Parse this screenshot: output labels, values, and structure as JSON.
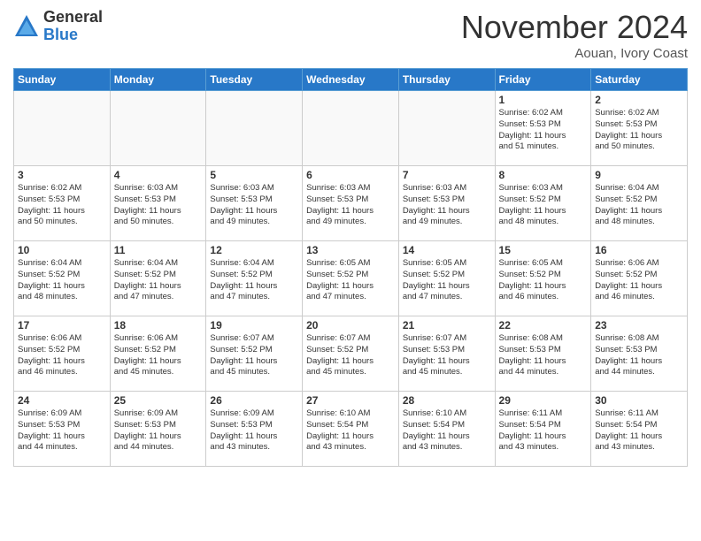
{
  "header": {
    "logo_general": "General",
    "logo_blue": "Blue",
    "month_title": "November 2024",
    "location": "Aouan, Ivory Coast"
  },
  "weekdays": [
    "Sunday",
    "Monday",
    "Tuesday",
    "Wednesday",
    "Thursday",
    "Friday",
    "Saturday"
  ],
  "weeks": [
    [
      {
        "day": "",
        "info": ""
      },
      {
        "day": "",
        "info": ""
      },
      {
        "day": "",
        "info": ""
      },
      {
        "day": "",
        "info": ""
      },
      {
        "day": "",
        "info": ""
      },
      {
        "day": "1",
        "info": "Sunrise: 6:02 AM\nSunset: 5:53 PM\nDaylight: 11 hours\nand 51 minutes."
      },
      {
        "day": "2",
        "info": "Sunrise: 6:02 AM\nSunset: 5:53 PM\nDaylight: 11 hours\nand 50 minutes."
      }
    ],
    [
      {
        "day": "3",
        "info": "Sunrise: 6:02 AM\nSunset: 5:53 PM\nDaylight: 11 hours\nand 50 minutes."
      },
      {
        "day": "4",
        "info": "Sunrise: 6:03 AM\nSunset: 5:53 PM\nDaylight: 11 hours\nand 50 minutes."
      },
      {
        "day": "5",
        "info": "Sunrise: 6:03 AM\nSunset: 5:53 PM\nDaylight: 11 hours\nand 49 minutes."
      },
      {
        "day": "6",
        "info": "Sunrise: 6:03 AM\nSunset: 5:53 PM\nDaylight: 11 hours\nand 49 minutes."
      },
      {
        "day": "7",
        "info": "Sunrise: 6:03 AM\nSunset: 5:53 PM\nDaylight: 11 hours\nand 49 minutes."
      },
      {
        "day": "8",
        "info": "Sunrise: 6:03 AM\nSunset: 5:52 PM\nDaylight: 11 hours\nand 48 minutes."
      },
      {
        "day": "9",
        "info": "Sunrise: 6:04 AM\nSunset: 5:52 PM\nDaylight: 11 hours\nand 48 minutes."
      }
    ],
    [
      {
        "day": "10",
        "info": "Sunrise: 6:04 AM\nSunset: 5:52 PM\nDaylight: 11 hours\nand 48 minutes."
      },
      {
        "day": "11",
        "info": "Sunrise: 6:04 AM\nSunset: 5:52 PM\nDaylight: 11 hours\nand 47 minutes."
      },
      {
        "day": "12",
        "info": "Sunrise: 6:04 AM\nSunset: 5:52 PM\nDaylight: 11 hours\nand 47 minutes."
      },
      {
        "day": "13",
        "info": "Sunrise: 6:05 AM\nSunset: 5:52 PM\nDaylight: 11 hours\nand 47 minutes."
      },
      {
        "day": "14",
        "info": "Sunrise: 6:05 AM\nSunset: 5:52 PM\nDaylight: 11 hours\nand 47 minutes."
      },
      {
        "day": "15",
        "info": "Sunrise: 6:05 AM\nSunset: 5:52 PM\nDaylight: 11 hours\nand 46 minutes."
      },
      {
        "day": "16",
        "info": "Sunrise: 6:06 AM\nSunset: 5:52 PM\nDaylight: 11 hours\nand 46 minutes."
      }
    ],
    [
      {
        "day": "17",
        "info": "Sunrise: 6:06 AM\nSunset: 5:52 PM\nDaylight: 11 hours\nand 46 minutes."
      },
      {
        "day": "18",
        "info": "Sunrise: 6:06 AM\nSunset: 5:52 PM\nDaylight: 11 hours\nand 45 minutes."
      },
      {
        "day": "19",
        "info": "Sunrise: 6:07 AM\nSunset: 5:52 PM\nDaylight: 11 hours\nand 45 minutes."
      },
      {
        "day": "20",
        "info": "Sunrise: 6:07 AM\nSunset: 5:52 PM\nDaylight: 11 hours\nand 45 minutes."
      },
      {
        "day": "21",
        "info": "Sunrise: 6:07 AM\nSunset: 5:53 PM\nDaylight: 11 hours\nand 45 minutes."
      },
      {
        "day": "22",
        "info": "Sunrise: 6:08 AM\nSunset: 5:53 PM\nDaylight: 11 hours\nand 44 minutes."
      },
      {
        "day": "23",
        "info": "Sunrise: 6:08 AM\nSunset: 5:53 PM\nDaylight: 11 hours\nand 44 minutes."
      }
    ],
    [
      {
        "day": "24",
        "info": "Sunrise: 6:09 AM\nSunset: 5:53 PM\nDaylight: 11 hours\nand 44 minutes."
      },
      {
        "day": "25",
        "info": "Sunrise: 6:09 AM\nSunset: 5:53 PM\nDaylight: 11 hours\nand 44 minutes."
      },
      {
        "day": "26",
        "info": "Sunrise: 6:09 AM\nSunset: 5:53 PM\nDaylight: 11 hours\nand 43 minutes."
      },
      {
        "day": "27",
        "info": "Sunrise: 6:10 AM\nSunset: 5:54 PM\nDaylight: 11 hours\nand 43 minutes."
      },
      {
        "day": "28",
        "info": "Sunrise: 6:10 AM\nSunset: 5:54 PM\nDaylight: 11 hours\nand 43 minutes."
      },
      {
        "day": "29",
        "info": "Sunrise: 6:11 AM\nSunset: 5:54 PM\nDaylight: 11 hours\nand 43 minutes."
      },
      {
        "day": "30",
        "info": "Sunrise: 6:11 AM\nSunset: 5:54 PM\nDaylight: 11 hours\nand 43 minutes."
      }
    ]
  ]
}
